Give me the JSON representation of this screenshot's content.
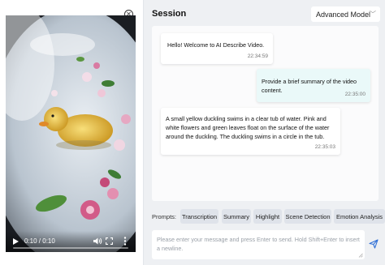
{
  "video": {
    "time": "0:10 / 0:10",
    "progress": 1.0
  },
  "session": {
    "title": "Session",
    "model": "Advanced Model",
    "messages": [
      {
        "role": "assistant",
        "text": "Hello! Welcome to AI Describe Video.",
        "time": "22:34:59"
      },
      {
        "role": "user",
        "text": "Provide a brief summary of the video content.",
        "time": "22:35:00"
      },
      {
        "role": "assistant",
        "text": "A small yellow duckling swims in a clear tub of water. Pink and white flowers and green leaves float on the surface of the water around the duckling. The duckling swims in a circle in the tub.",
        "time": "22:35:03"
      }
    ]
  },
  "prompts": {
    "label": "Prompts:",
    "chips": [
      "Transcription",
      "Summary",
      "Highlight",
      "Scene Detection",
      "Emotion Analysis"
    ]
  },
  "input": {
    "placeholder": "Please enter your message and press Enter to send. Hold Shift+Enter to insert a newline."
  },
  "colors": {
    "user_bubble": "#eaf9f9",
    "chip_bg": "#dfe3ea",
    "send_icon": "#2f6fd6"
  }
}
